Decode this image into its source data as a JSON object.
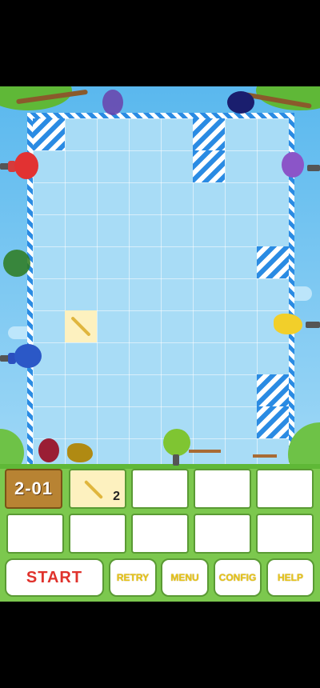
{
  "level": {
    "label": "2-01"
  },
  "tool": {
    "name": "stick",
    "count": "2"
  },
  "buttons": {
    "start": "START",
    "retry": "RETRY",
    "menu": "MENU",
    "config": "CONFIG",
    "help": "HELP"
  },
  "icons": {
    "top_grapes": "grapes-silhouette-icon",
    "top_plum": "plum-silhouette-icon",
    "left_strawberry": "strawberry-icon",
    "left_apple": "apple-silhouette-icon",
    "left_blueberry": "blueberry-icon",
    "right_grapes": "grapes-icon",
    "right_banana": "banana-icon",
    "bottom_apple": "green-apple-icon",
    "bottom_strawberry": "strawberry-silhouette-icon",
    "bottom_banana": "banana-silhouette-icon"
  },
  "colors": {
    "board": "#a8dcf6",
    "stripe": "#2a8be3",
    "start_text": "#e0322c",
    "button_text": "#e7c41a",
    "level_bg": "#b88333"
  }
}
